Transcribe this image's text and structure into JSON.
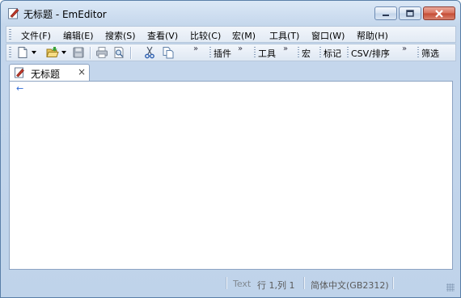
{
  "window": {
    "title": "无标题 - EmEditor",
    "buttons": [
      "minimize-icon",
      "maximize-icon",
      "close-icon"
    ]
  },
  "menubar": {
    "items": [
      {
        "label": "文件(F)"
      },
      {
        "label": "编辑(E)"
      },
      {
        "label": "搜索(S)"
      },
      {
        "label": "查看(V)"
      },
      {
        "label": "比较(C)"
      },
      {
        "label": "宏(M)"
      },
      {
        "label": "工具(T)"
      },
      {
        "label": "窗口(W)"
      },
      {
        "label": "帮助(H)"
      }
    ]
  },
  "toolbar": {
    "icons": [
      "new-file-icon",
      "open-folder-icon",
      "save-icon",
      "print-icon",
      "print-preview-icon",
      "cut-icon",
      "copy-icon"
    ],
    "overflow": "»",
    "groups": [
      {
        "label": "插件"
      },
      {
        "label": "工具"
      },
      {
        "label": "宏"
      },
      {
        "label": "标记"
      },
      {
        "label": "CSV/排序"
      },
      {
        "label": "筛选"
      }
    ]
  },
  "tabs": [
    {
      "label": "无标题",
      "close": "×"
    }
  ],
  "editor": {
    "eof_mark": "←"
  },
  "statusbar": {
    "mode": "Text",
    "position": "行 1,列 1",
    "encoding": "简体中文(GB2312)"
  },
  "colors": {
    "frame": "#bfd3ea",
    "close_button": "#c44a33",
    "eof_mark": "#2e6ad6"
  }
}
